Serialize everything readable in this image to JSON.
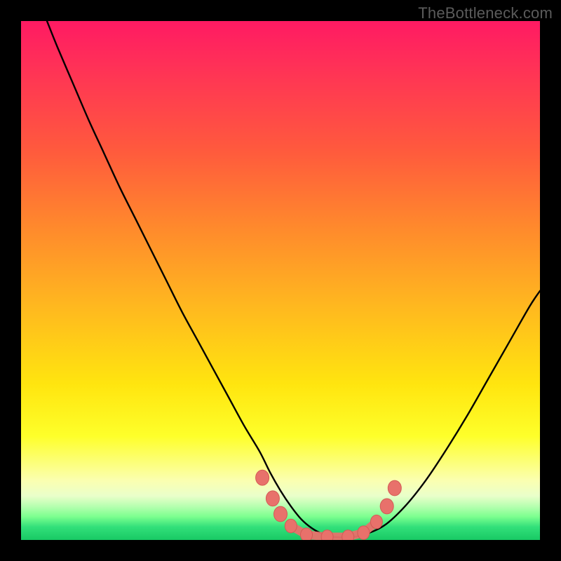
{
  "watermark": "TheBottleneck.com",
  "colors": {
    "frame": "#000000",
    "curve_stroke": "#000000",
    "marker_fill": "#e8716b",
    "marker_stroke": "#d35a55",
    "gradient_top": "#ff1a63",
    "gradient_bottom": "#18c964"
  },
  "chart_data": {
    "type": "line",
    "title": "",
    "xlabel": "",
    "ylabel": "",
    "xlim": [
      0,
      100
    ],
    "ylim": [
      0,
      100
    ],
    "series": [
      {
        "name": "bottleneck-curve",
        "x": [
          5,
          7,
          10,
          13,
          16,
          19,
          22,
          25,
          28,
          31,
          34,
          37,
          40,
          43,
          46,
          48,
          50,
          52,
          54,
          56,
          58,
          60,
          63,
          66,
          70,
          74,
          78,
          82,
          86,
          90,
          94,
          98,
          100
        ],
        "y": [
          100,
          95,
          88,
          81,
          74.5,
          68,
          62,
          56,
          50,
          44,
          38.5,
          33,
          27.5,
          22,
          17,
          13,
          9.5,
          6.5,
          4,
          2.3,
          1.2,
          0.6,
          0.5,
          1.0,
          2.8,
          6.5,
          11.5,
          17.5,
          24,
          31,
          38,
          45,
          48
        ]
      }
    ],
    "markers": {
      "name": "flat-zone-beads",
      "points": [
        {
          "x": 46.5,
          "y": 12.0
        },
        {
          "x": 48.5,
          "y": 8.0
        },
        {
          "x": 50.0,
          "y": 5.0
        },
        {
          "x": 52.0,
          "y": 2.7
        },
        {
          "x": 55.0,
          "y": 1.0
        },
        {
          "x": 59.0,
          "y": 0.6
        },
        {
          "x": 63.0,
          "y": 0.6
        },
        {
          "x": 66.0,
          "y": 1.4
        },
        {
          "x": 68.5,
          "y": 3.5
        },
        {
          "x": 70.5,
          "y": 6.5
        },
        {
          "x": 72.0,
          "y": 10.0
        }
      ]
    }
  }
}
